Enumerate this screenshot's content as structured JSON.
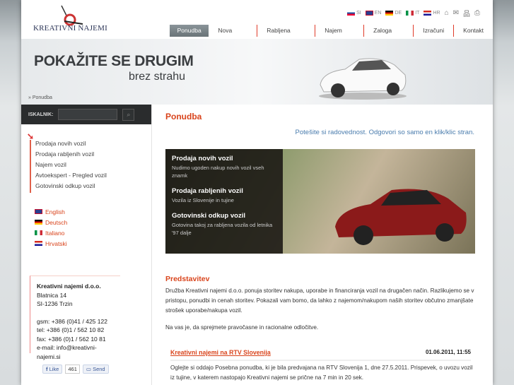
{
  "header": {
    "logo": "KREATIVNI NAJEMI",
    "languages": [
      {
        "code": "SI",
        "color": "#1d4fa0"
      },
      {
        "code": "EN",
        "color": "#c8102e"
      },
      {
        "code": "DE",
        "color": "#000000"
      },
      {
        "code": "IT",
        "color": "#009246"
      },
      {
        "code": "HR",
        "color": "#d52b1e"
      }
    ],
    "tools": [
      "home-icon",
      "mail-icon",
      "sitemap-icon",
      "print-icon"
    ],
    "nav": [
      "Ponudba",
      "Nova vozila",
      "Rabljena vozila",
      "Najem vozil",
      "Zaloga vozil",
      "Izračuni",
      "Kontakt"
    ]
  },
  "banner": {
    "headline": "POKAŽITE SE DRUGIM",
    "subline": "brez strahu",
    "breadcrumb": "» Ponudba"
  },
  "sidebar": {
    "search_label": "ISKALNIK:",
    "search_value": "",
    "menu": [
      "Prodaja novih vozil",
      "Prodaja rabljenih vozil",
      "Najem vozil",
      "Avtoekspert - Pregled vozil",
      "Gotovinski odkup vozil"
    ],
    "languages": [
      "English",
      "Deutsch",
      "Italiano",
      "Hrvatski"
    ],
    "contact": {
      "company": "Kreativni najemi d.o.o.",
      "street": "Blatnica 14",
      "city": "SI-1236 Trzin",
      "gsm": "gsm: +386 (0)41 / 425 122",
      "tel": "tel: +386 (0)1 / 562 10 82",
      "fax": "fax: +386 (0)1 / 562 10 81",
      "email": "e-mail: info@kreativni-najemi.si"
    },
    "social": {
      "like": "Like",
      "count": "461",
      "send": "Send"
    }
  },
  "main": {
    "title": "Ponudba",
    "tagline": "Potešite si radovednost. Odgovori so samo en klik/klic stran.",
    "promo": [
      {
        "title": "Prodaja novih vozil",
        "text": "Nudimo ugoden nakup novih vozil vseh znamk"
      },
      {
        "title": "Prodaja rabljenih vozil",
        "text": "Vozila iz Slovenije in tujine"
      },
      {
        "title": "Gotovinski odkup vozil",
        "text": "Gotovina takoj za rabljena vozila od letnika '97 dalje"
      }
    ],
    "section_title": "Predstavitev",
    "intro": "Družba Kreativni najemi d.o.o. ponuja storitev nakupa, uporabe in financiranja vozil na drugačen način. Razlikujemo se v pristopu, ponudbi in cenah storitev. Pokazali vam bomo, da lahko z najemom/nakupom naših storitev občutno zmanjšate strošek uporabe/nakupa vozil.",
    "intro2": "Na vas je, da sprejmete pravočasne in racionalne odločitve.",
    "news": {
      "title": "Kreativni najemi na RTV Slovenija",
      "date": "01.06.2011, 11:55",
      "text": "Oglejte si oddajo Posebna ponudba, ki je bila predvajana na RTV Slovenija 1, dne 27.5.2011. Prispevek, o uvozu vozil iz tujine, v katerem nastopajo Kreativni najemi se prične na 7 min in 20 sek."
    }
  }
}
